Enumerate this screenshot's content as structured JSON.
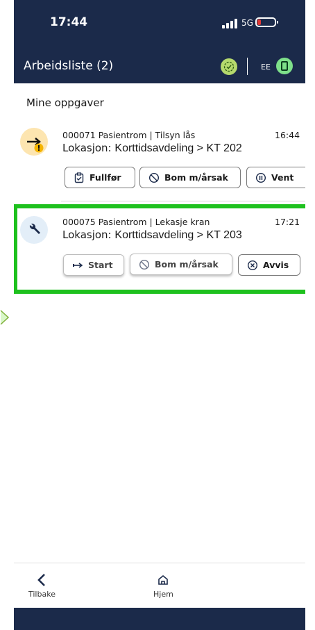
{
  "status_bar": {
    "time": "17:44",
    "network": "5G"
  },
  "header": {
    "title": "Arbeidsliste (2)",
    "language": "EE"
  },
  "section_title": "Mine oppgaver",
  "tasks": [
    {
      "id_title": "000071 Pasientrom | Tilsyn lås",
      "time": "16:44",
      "location_label": "Lokasjon:",
      "location": "Korttidsavdeling > KT 202",
      "icon": "arrow-right-warning-icon",
      "buttons": [
        "Fullfør",
        "Bom m/årsak",
        "Vent"
      ]
    },
    {
      "id_title": "000075 Pasientrom | Lekasje kran",
      "time": "17:21",
      "location_label": "Lokasjon:",
      "location": "Korttidsavdeling > KT 203",
      "icon": "wrench-icon",
      "buttons": [
        "Start",
        "Bom m/årsak",
        "Avvis"
      ]
    }
  ],
  "nav": {
    "back": "Tilbake",
    "home": "Hjem"
  },
  "colors": {
    "header_bg": "#1b2a4a",
    "highlight": "#1ec11e",
    "sync_green": "#b5d96d",
    "device_green": "#7ee08a"
  }
}
